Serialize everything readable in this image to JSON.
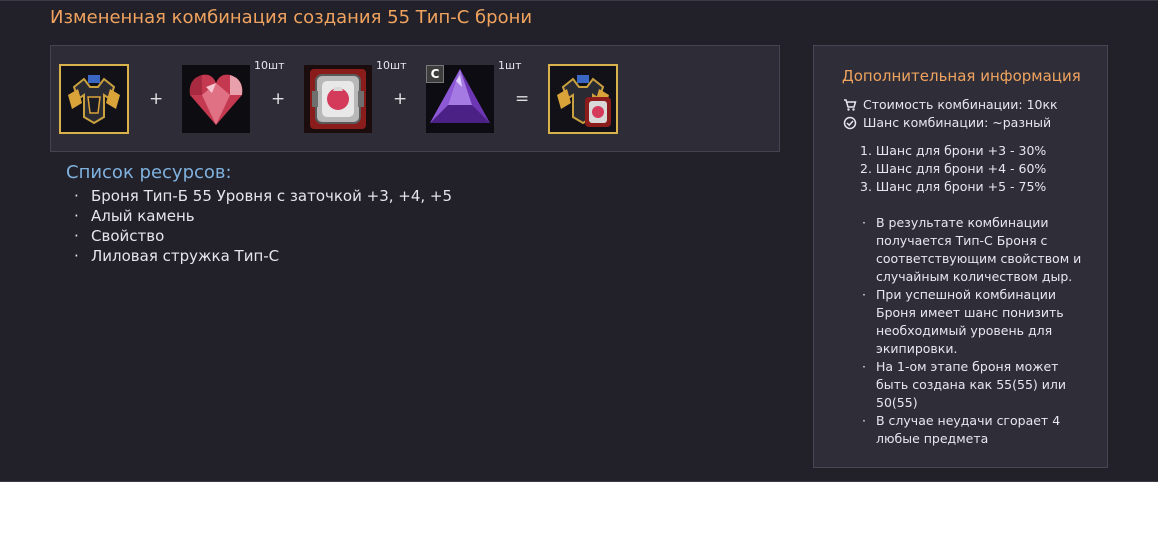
{
  "title": "Измененная комбинация создания 55 Тип-C брони",
  "recipe": {
    "ingredients": [
      {
        "name": "Броня Тип-Б 55 Уровня",
        "icon": "armor-b-icon",
        "qty": ""
      },
      {
        "name": "Алый камень",
        "icon": "red-gem-icon",
        "qty": "10шт"
      },
      {
        "name": "Свойство",
        "icon": "property-scroll-icon",
        "qty": "10шт"
      },
      {
        "name": "Лиловая стружка Тип-С",
        "icon": "purple-crystal-icon",
        "qty": "1шт",
        "grade": "C"
      }
    ],
    "plus": "+",
    "equals": "=",
    "result": {
      "name": "Броня Тип-C",
      "icon": "armor-c-icon"
    }
  },
  "resources": {
    "title": "Список ресурсов:",
    "items": [
      "Броня Тип-Б 55 Уровня с заточкой +3, +4, +5",
      "Алый камень",
      "Свойство",
      "Лиловая стружка Тип-С"
    ]
  },
  "info": {
    "title": "Дополнительная информация",
    "cost": "Стоимость комбинации: 10кк",
    "chance": "Шанс комбинации: ~разный",
    "chances": [
      "1. Шанс для брони +3 - 30%",
      "2. Шанс для брони +4 - 60%",
      "3. Шанс для брони +5 - 75%"
    ],
    "notes": [
      "В результате комбинации получается Тип-С Броня с соответствующим свойством и случайным количеством дыр.",
      "При успешной комбинации Броня имеет шанс понизить необходимый уровень для экипировки.",
      "На 1-ом этапе броня может быть создана как 55(55) или 50(55)",
      "В случае неудачи сгорает 4 любые предмета"
    ]
  },
  "colors": {
    "background": "#222129",
    "title_accent": "#f0a35f",
    "resources_title": "#7fb2df",
    "frame_gold": "#d9b24c"
  }
}
